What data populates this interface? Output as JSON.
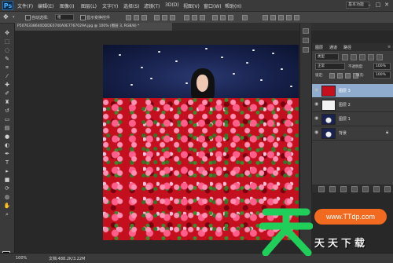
{
  "app": {
    "logo": "Ps"
  },
  "menu": {
    "items": [
      "文件(F)",
      "编辑(E)",
      "图像(I)",
      "图层(L)",
      "文字(Y)",
      "选择(S)",
      "滤镜(T)",
      "3D(D)",
      "视图(V)",
      "窗口(W)",
      "帮助(H)"
    ]
  },
  "workspace": {
    "label": "基本功能"
  },
  "options": {
    "auto_select_label": "自动选择:",
    "auto_select_target": "组",
    "show_transform_label": "显示变换控件"
  },
  "document": {
    "tab_label": "P5076338640DDDE0740A0E7767029A.jpg @ 100% (图层 3, RGB/8) *"
  },
  "layers_panel": {
    "tabs": [
      "图层",
      "通道",
      "路径"
    ],
    "kind_label": "类型",
    "blend_mode": "正常",
    "opacity_label": "不透明度:",
    "opacity_value": "100%",
    "lock_label": "锁定:",
    "fill_label": "填充:",
    "fill_value": "100%",
    "layers": [
      {
        "name": "图层 3",
        "selected": true,
        "thumb": "fabric"
      },
      {
        "name": "图层 2",
        "selected": false,
        "thumb": "white"
      },
      {
        "name": "图层 1",
        "selected": false,
        "thumb": "photo"
      },
      {
        "name": "背景",
        "selected": false,
        "thumb": "photo"
      }
    ]
  },
  "status": {
    "zoom": "100%",
    "doc_size": "文档:488.2K/3.22M"
  },
  "watermark": {
    "site": "www.TTdp.com",
    "brand": "天天下载"
  },
  "colors": {
    "fabric_red": "#c4101e",
    "sky_navy": "#16204a",
    "accent_orange": "#f26a1f",
    "selection_blue": "#8faccf"
  }
}
